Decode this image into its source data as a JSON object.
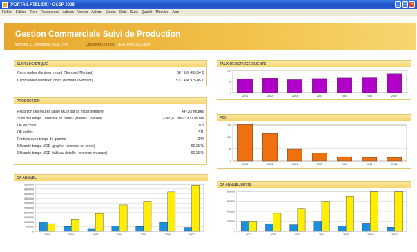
{
  "window": {
    "title": "[PORTAIL ATELIER] - GCSP 2008",
    "buttons": [
      "_",
      "□",
      "×"
    ]
  },
  "menu": [
    "Fichier",
    "Edition",
    "Tiers",
    "Ressources",
    "Articles",
    "Ventes",
    "Achats",
    "Stocks",
    "Ordo",
    "Suivi",
    "Qualité",
    "Modules",
    "Aide"
  ],
  "header": {
    "title": "Gestion Commerciale Suivi de Production",
    "date": "vendredi 11 septembre 2009 17:06",
    "user_label": "Utilisateur Courant",
    "environment": "TEST PRODUCTION"
  },
  "suivi_logistique": {
    "title": "Suivi Logistique",
    "rows": [
      {
        "label": "Commandes clients en retard (Nombre / Montant)",
        "value": "68 / 969 453,64 €"
      },
      {
        "label": "Commandes clients en cours (Nombre / Montant)",
        "value": "75 / 1 498 975,45 €"
      }
    ]
  },
  "production": {
    "title": "Production",
    "rows": [
      {
        "label": "Répartion des heures saisie MOD par lot et par semaine",
        "value": "447,25 heures"
      },
      {
        "label": "Suivi des temps - exercice en cours - (Prévus / Passés)",
        "value": "2 569,67 hrs / 3 877,96 hrs"
      },
      {
        "label": "OF en cours",
        "value": "113"
      },
      {
        "label": "OF soldés",
        "value": "311"
      },
      {
        "label": "Produits avec temps de gamme",
        "value": "244"
      },
      {
        "label": "Efficacité temps MOD (graphe - exercice en cours)",
        "value": "66,35 %"
      },
      {
        "label": "Efficacité temps MOD (tableau détaillé - exercice en cours)",
        "value": "66,35 %"
      }
    ]
  },
  "chart_data": [
    {
      "id": "taux_service",
      "type": "bar",
      "title": "Taux de Service Clients",
      "categories": [
        "2001",
        "2002",
        "2003",
        "2004",
        "2005",
        "2006",
        "2007"
      ],
      "series": [
        {
          "values": [
            62,
            65,
            58,
            63,
            66,
            67,
            85
          ]
        }
      ],
      "ylim": [
        0,
        100
      ],
      "yticks": [
        "100",
        "50",
        "0"
      ],
      "colors": [
        "#b000c8"
      ]
    },
    {
      "id": "pdc",
      "type": "bar",
      "title": "PDC",
      "categories": [
        "0902",
        "0903",
        "0904",
        "0905",
        "0906",
        "0943",
        "0944"
      ],
      "series": [
        {
          "values": [
            152,
            115,
            49,
            33,
            17,
            14,
            14
          ]
        }
      ],
      "ylim": [
        0,
        150
      ],
      "yticks": [
        "150",
        "100",
        "50",
        "0"
      ],
      "colors": [
        "#f07010"
      ]
    },
    {
      "id": "ca_annuel",
      "type": "bar",
      "title": "CA Annuel",
      "categories": [
        "2001",
        "2002",
        "2003",
        "2004",
        "2005",
        "2006",
        "2007"
      ],
      "series": [
        {
          "values": [
            1000000,
            500000,
            300000,
            550000,
            500000,
            950000,
            400000
          ]
        },
        {
          "values": [
            800000,
            1300000,
            1900000,
            2800000,
            3200000,
            4200000,
            4900000
          ]
        }
      ],
      "ylim": [
        0,
        5000000
      ],
      "yticks": [
        "5000000",
        "4500000",
        "4000000",
        "3500000",
        "3000000",
        "2500000",
        "2000000",
        "1500000",
        "1000000",
        "500000",
        "0"
      ],
      "colors": [
        "#1a8fe0",
        "#ffee00"
      ]
    },
    {
      "id": "ca_devis",
      "type": "bar",
      "title": "CA Annuel Devis",
      "categories": [
        "2001",
        "2002",
        "2003",
        "2004",
        "2005",
        "2006",
        "2007"
      ],
      "series": [
        {
          "values": [
            200000,
            150000,
            130000,
            200000,
            100000,
            160000,
            80000
          ]
        },
        {
          "values": [
            200000,
            360000,
            460000,
            600000,
            700000,
            790000,
            790000
          ]
        }
      ],
      "ylim": [
        0,
        800000
      ],
      "yticks": [
        "800000",
        "600000",
        "400000",
        "200000",
        "0"
      ],
      "colors": [
        "#1a8fe0",
        "#ffee00"
      ]
    }
  ]
}
